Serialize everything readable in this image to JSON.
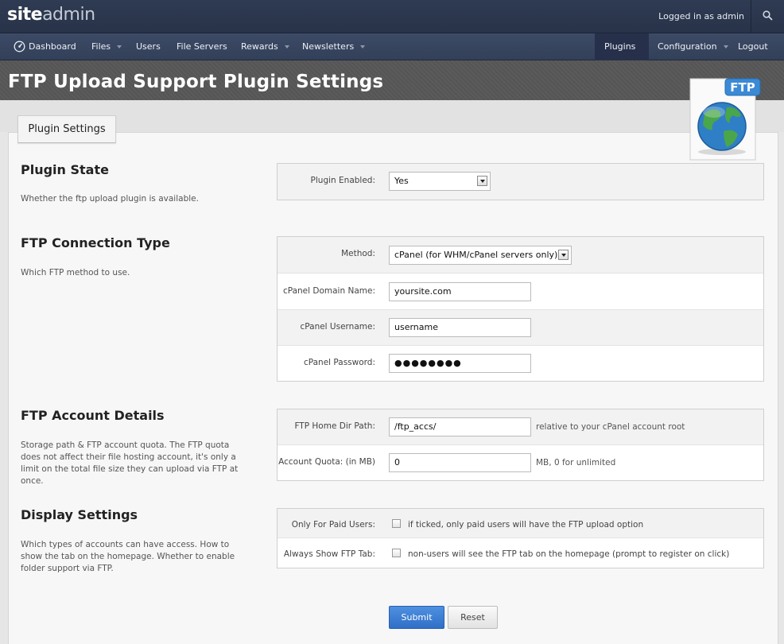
{
  "topbar": {
    "logo_strong": "site",
    "logo_light": "admin",
    "logged_in": "Logged in as admin"
  },
  "nav": {
    "items": [
      {
        "label": "Dashboard"
      },
      {
        "label": "Files"
      },
      {
        "label": "Users"
      },
      {
        "label": "File Servers"
      },
      {
        "label": "Rewards"
      },
      {
        "label": "Newsletters"
      },
      {
        "label": "Plugins"
      },
      {
        "label": "Configuration"
      },
      {
        "label": "Logout"
      }
    ]
  },
  "page": {
    "title": "FTP Upload Support Plugin Settings",
    "tab": "Plugin Settings",
    "badge": "FTP"
  },
  "sections": {
    "plugin_state": {
      "title": "Plugin State",
      "desc": "Whether the ftp upload plugin is available.",
      "enabled_label": "Plugin Enabled:",
      "enabled_value": "Yes"
    },
    "connection": {
      "title": "FTP Connection Type",
      "desc": "Which FTP method to use.",
      "method_label": "Method:",
      "method_value": "cPanel (for WHM/cPanel servers only)",
      "domain_label": "cPanel Domain Name:",
      "domain_value": "yoursite.com",
      "username_label": "cPanel Username:",
      "username_value": "username",
      "password_label": "cPanel Password:",
      "password_value": "●●●●●●●●"
    },
    "account": {
      "title": "FTP Account Details",
      "desc": "Storage path & FTP account quota. The FTP quota does not affect their file hosting account, it's only a limit on the total file size they can upload via FTP at once.",
      "home_label": "FTP Home Dir Path:",
      "home_value": "/ftp_accs/",
      "home_hint": "relative to your cPanel account root",
      "quota_label": "Account Quota: (in MB)",
      "quota_value": "0",
      "quota_hint": "MB, 0 for unlimited"
    },
    "display": {
      "title": "Display Settings",
      "desc": "Which types of accounts can have access. How to show the tab on the homepage. Whether to enable folder support via FTP.",
      "paid_label": "Only For Paid Users:",
      "paid_hint": "if ticked, only paid users will have the FTP upload option",
      "tab_label": "Always Show FTP Tab:",
      "tab_hint": "non-users will see the FTP tab on the homepage (prompt to register on click)"
    }
  },
  "actions": {
    "submit": "Submit",
    "reset": "Reset"
  }
}
